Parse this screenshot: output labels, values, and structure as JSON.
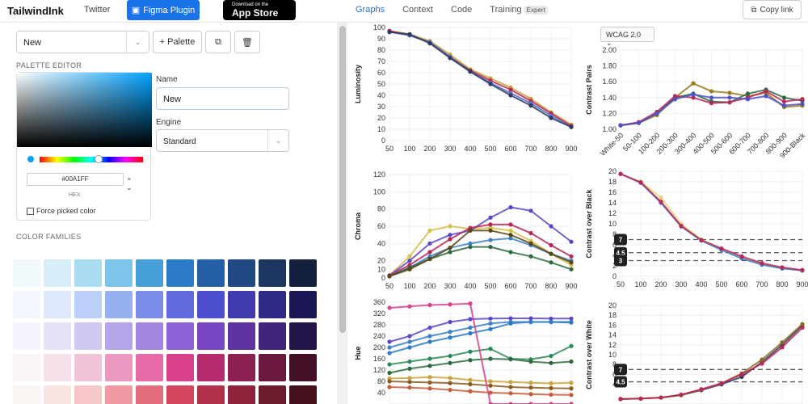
{
  "header": {
    "brand": "TailwindInk",
    "twitter": "Twitter",
    "figma": "Figma Plugin",
    "appstore_top": "Download on the",
    "appstore_main": "App Store",
    "copy_link": "Copy link"
  },
  "tabs": [
    {
      "label": "Graphs",
      "active": true
    },
    {
      "label": "Context"
    },
    {
      "label": "Code"
    },
    {
      "label": "Training",
      "badge": "Expert"
    }
  ],
  "left": {
    "palette_select": "New",
    "palette_button": "+ Palette",
    "palette_editor_label": "PALETTE EDITOR",
    "hex_value": "#00A1FF",
    "hex_label": "HEX",
    "force_label": "Force picked color",
    "name_label": "Name",
    "name_value": "New",
    "engine_label": "Engine",
    "engine_value": "Standard",
    "families_label": "COLOR FAMILIES",
    "swatch_rows": [
      [
        "#f1f8fb",
        "#d7eef8",
        "#a9dcf3",
        "#7cc4ea",
        "#47a0d8",
        "#2b7bc7",
        "#255fa6",
        "#214883",
        "#1d3660",
        "#13213f"
      ],
      [
        "#f3f6fc",
        "#dfe8fb",
        "#bccff6",
        "#97b0f0",
        "#7a8ce7",
        "#6169df",
        "#4e4fd0",
        "#3f3aae",
        "#2f2a85",
        "#1b1855"
      ],
      [
        "#f5f4fc",
        "#e6e2f8",
        "#d0c8f2",
        "#b6a4e9",
        "#a384e0",
        "#8e61d6",
        "#7845c4",
        "#5f33a0",
        "#41257a",
        "#23154a"
      ],
      [
        "#fbf4f6",
        "#f6e0ea",
        "#f0c3d8",
        "#eb98c1",
        "#e56aa5",
        "#d8408c",
        "#b52d6e",
        "#8d2052",
        "#6a183c",
        "#411026"
      ],
      [
        "#fcf6f5",
        "#f9e4e4",
        "#f5c7c9",
        "#ef9aa2",
        "#e36f7d",
        "#d24660",
        "#b1314a",
        "#8e233b",
        "#6c1a2d",
        "#44101b"
      ]
    ]
  },
  "wcag_select": "WCAG 2.0",
  "chart_data": [
    {
      "type": "line",
      "title": "",
      "ylabel": "Luminosity",
      "x": [
        "50",
        "100",
        "200",
        "300",
        "400",
        "500",
        "600",
        "700",
        "800",
        "900"
      ],
      "ylim": [
        0,
        100
      ],
      "yticks": [
        0,
        10,
        20,
        30,
        40,
        50,
        60,
        70,
        80,
        90,
        100
      ],
      "series": [
        {
          "values": [
            97,
            94,
            88,
            76,
            63,
            55,
            47,
            37,
            25,
            14
          ],
          "color": "#c8a43a"
        },
        {
          "values": [
            97,
            93,
            87,
            74,
            62,
            53,
            45,
            35,
            24,
            13
          ],
          "color": "#b92658"
        },
        {
          "values": [
            96,
            93,
            87,
            74,
            61,
            51,
            42,
            33,
            22,
            12
          ],
          "color": "#4f73c9"
        },
        {
          "values": [
            96,
            94,
            86,
            73,
            61,
            50,
            40,
            31,
            20,
            12
          ],
          "color": "#2b3a5f"
        }
      ]
    },
    {
      "type": "line",
      "ylabel": "Contrast Pairs",
      "x": [
        "White-50",
        "50-100",
        "100-200",
        "200-300",
        "300-400",
        "400-500",
        "500-600",
        "600-700",
        "700-800",
        "800-900",
        "900-Black"
      ],
      "ylim": [
        1.0,
        2.0
      ],
      "yticks": [
        1.0,
        1.2,
        1.4,
        1.6,
        1.8,
        2.0
      ],
      "series": [
        {
          "values": [
            1.05,
            1.08,
            1.18,
            1.4,
            1.58,
            1.48,
            1.46,
            1.42,
            1.46,
            1.28,
            1.3
          ],
          "color": "#9a7a1e"
        },
        {
          "values": [
            1.05,
            1.08,
            1.2,
            1.4,
            1.45,
            1.35,
            1.34,
            1.45,
            1.5,
            1.4,
            1.36
          ],
          "color": "#2a6b3f"
        },
        {
          "values": [
            1.05,
            1.09,
            1.22,
            1.42,
            1.4,
            1.33,
            1.34,
            1.4,
            1.48,
            1.35,
            1.38
          ],
          "color": "#b92658"
        },
        {
          "values": [
            1.05,
            1.08,
            1.2,
            1.38,
            1.44,
            1.4,
            1.4,
            1.38,
            1.42,
            1.3,
            1.32
          ],
          "color": "#4f4fc9"
        }
      ]
    },
    {
      "type": "line",
      "ylabel": "Chroma",
      "x": [
        "50",
        "100",
        "200",
        "300",
        "400",
        "500",
        "600",
        "700",
        "800",
        "900"
      ],
      "ylim": [
        0,
        120
      ],
      "yticks": [
        0,
        10,
        20,
        40,
        60,
        80,
        100,
        120
      ],
      "series": [
        {
          "values": [
            3,
            25,
            55,
            60,
            57,
            58,
            55,
            43,
            28,
            15
          ],
          "color": "#d4c04a"
        },
        {
          "values": [
            3,
            20,
            40,
            50,
            55,
            70,
            82,
            78,
            60,
            42
          ],
          "color": "#5a46c9"
        },
        {
          "values": [
            3,
            15,
            30,
            45,
            58,
            62,
            62,
            52,
            38,
            25
          ],
          "color": "#b92658"
        },
        {
          "values": [
            2,
            12,
            25,
            35,
            40,
            44,
            46,
            38,
            28,
            20
          ],
          "color": "#3d7fc4"
        },
        {
          "values": [
            2,
            12,
            22,
            30,
            36,
            36,
            30,
            25,
            18,
            10
          ],
          "color": "#2b6a3e"
        },
        {
          "values": [
            2,
            10,
            22,
            35,
            55,
            55,
            50,
            40,
            28,
            18
          ],
          "color": "#5b4513"
        }
      ]
    },
    {
      "type": "line",
      "ylabel": "Contrast over Black",
      "x": [
        "50",
        "100",
        "200",
        "300",
        "400",
        "500",
        "600",
        "700",
        "800",
        "900"
      ],
      "ylim": [
        0,
        20
      ],
      "yticks": [
        0,
        2,
        4,
        6,
        8,
        10,
        12,
        14,
        16,
        18,
        20
      ],
      "reference_lines": [
        "7",
        "4.5",
        "3"
      ],
      "series": [
        {
          "values": [
            19.5,
            18,
            15,
            10,
            7,
            5.2,
            3.6,
            2.3,
            1.6,
            1.1
          ],
          "color": "#e8d27a"
        },
        {
          "values": [
            19.5,
            17.8,
            14,
            9.5,
            6.8,
            5.0,
            3.4,
            2.2,
            1.5,
            1.1
          ],
          "color": "#3d7fc4"
        },
        {
          "values": [
            19.5,
            17.9,
            14.2,
            9.6,
            6.9,
            5.3,
            3.8,
            2.5,
            1.7,
            1.2
          ],
          "color": "#b92658"
        }
      ]
    },
    {
      "type": "line",
      "ylabel": "Hue",
      "x": [
        "50",
        "100",
        "200",
        "300",
        "400",
        "500",
        "600",
        "700",
        "800",
        "900"
      ],
      "ylim": [
        0,
        360
      ],
      "yticks": [
        40,
        80,
        120,
        160,
        200,
        240,
        280,
        320,
        360
      ],
      "series": [
        {
          "values": [
            220,
            240,
            270,
            290,
            300,
            302,
            303,
            303,
            302,
            302
          ],
          "color": "#5a46c9"
        },
        {
          "values": [
            200,
            220,
            240,
            255,
            270,
            285,
            290,
            290,
            290,
            290
          ],
          "color": "#3d7fc4"
        },
        {
          "values": [
            180,
            200,
            220,
            235,
            250,
            265,
            285,
            290,
            290,
            288
          ],
          "color": "#2b7bc7"
        },
        {
          "values": [
            140,
            150,
            160,
            170,
            185,
            195,
            160,
            158,
            170,
            205
          ],
          "color": "#2b8a5a"
        },
        {
          "values": [
            110,
            125,
            135,
            145,
            155,
            160,
            158,
            150,
            145,
            150
          ],
          "color": "#2b6a3e"
        },
        {
          "values": [
            90,
            92,
            95,
            92,
            85,
            80,
            78,
            75,
            73,
            75
          ],
          "color": "#c8a43a"
        },
        {
          "values": [
            80,
            78,
            76,
            74,
            70,
            65,
            60,
            58,
            56,
            55
          ],
          "color": "#8a5a1e"
        },
        {
          "values": [
            60,
            58,
            55,
            50,
            45,
            40,
            38,
            35,
            33,
            32
          ],
          "color": "#c65a3a"
        },
        {
          "values": [
            340,
            345,
            350,
            352,
            355,
            0,
            0,
            0,
            0,
            0
          ],
          "color": "#d8408c"
        }
      ]
    },
    {
      "type": "line",
      "ylabel": "Contrast over White",
      "x": [
        "50",
        "100",
        "200",
        "300",
        "400",
        "500",
        "600",
        "700",
        "800",
        "900"
      ],
      "ylim": [
        0,
        20
      ],
      "yticks": [
        4,
        6,
        8,
        10,
        12,
        14,
        16,
        18,
        20
      ],
      "reference_lines": [
        "7",
        "4.5"
      ],
      "series": [
        {
          "values": [
            1.0,
            1.1,
            1.3,
            1.8,
            2.8,
            4.0,
            5.5,
            8.5,
            12,
            16
          ],
          "color": "#2b3a5f"
        },
        {
          "values": [
            1.0,
            1.1,
            1.3,
            1.8,
            2.9,
            4.2,
            6.2,
            9.0,
            12.5,
            16.2
          ],
          "color": "#8a6a1e"
        },
        {
          "values": [
            1.0,
            1.1,
            1.3,
            1.9,
            3.0,
            4.2,
            6.0,
            8.2,
            11.5,
            15.5
          ],
          "color": "#b92658"
        }
      ]
    }
  ]
}
